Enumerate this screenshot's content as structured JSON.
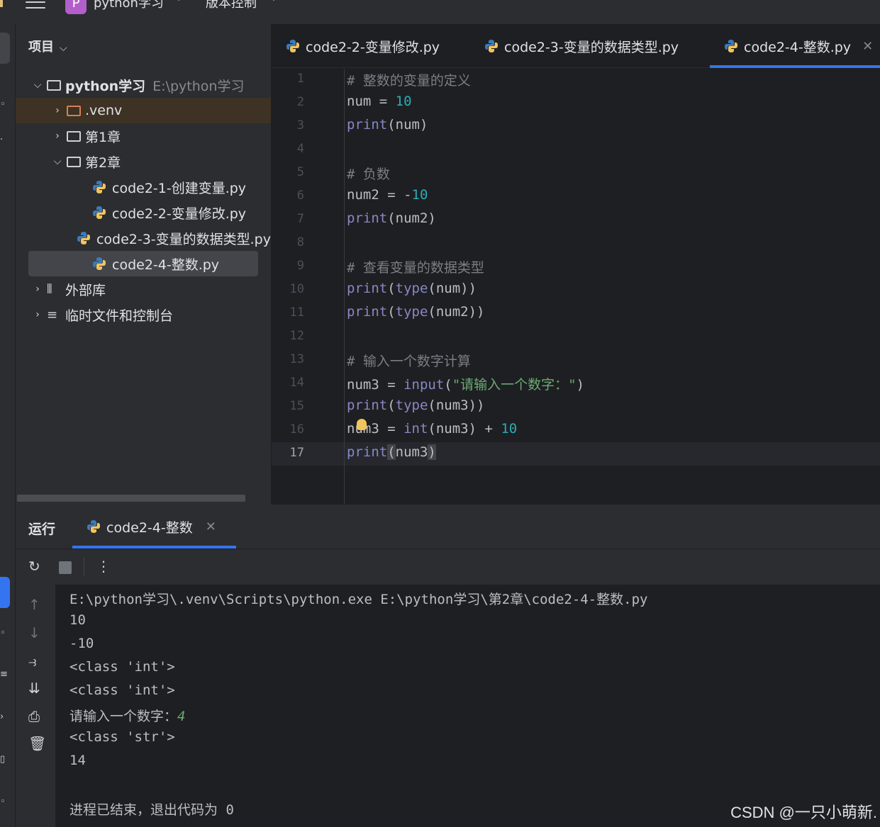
{
  "titlebar": {
    "project_badge": "P",
    "project_name": "python学习",
    "vcs_label": "版本控制"
  },
  "project_panel": {
    "header": "项目",
    "root": {
      "name": "python学习",
      "path": "E:\\python学习"
    },
    "items": [
      {
        "label": ".venv"
      },
      {
        "label": "第1章"
      },
      {
        "label": "第2章"
      },
      {
        "label": "code2-1-创建变量.py"
      },
      {
        "label": "code2-2-变量修改.py"
      },
      {
        "label": "code2-3-变量的数据类型.py"
      },
      {
        "label": "code2-4-整数.py"
      },
      {
        "label": "外部库"
      },
      {
        "label": "临时文件和控制台"
      }
    ]
  },
  "editor": {
    "tabs": [
      {
        "label": "code2-2-变量修改.py"
      },
      {
        "label": "code2-3-变量的数据类型.py"
      },
      {
        "label": "code2-4-整数.py",
        "active": true
      }
    ],
    "current_line": 17,
    "lines": [
      {
        "n": "1",
        "tokens": [
          {
            "t": "# 整数的变量的定义",
            "c": "comment"
          }
        ]
      },
      {
        "n": "2",
        "tokens": [
          {
            "t": "num = ",
            "c": ""
          },
          {
            "t": "10",
            "c": "num"
          }
        ]
      },
      {
        "n": "3",
        "tokens": [
          {
            "t": "print",
            "c": "builtin"
          },
          {
            "t": "(num)",
            "c": ""
          }
        ]
      },
      {
        "n": "4",
        "tokens": []
      },
      {
        "n": "5",
        "tokens": [
          {
            "t": "# 负数",
            "c": "comment"
          }
        ]
      },
      {
        "n": "6",
        "tokens": [
          {
            "t": "num2 = -",
            "c": ""
          },
          {
            "t": "10",
            "c": "num"
          }
        ]
      },
      {
        "n": "7",
        "tokens": [
          {
            "t": "print",
            "c": "builtin"
          },
          {
            "t": "(num2)",
            "c": ""
          }
        ]
      },
      {
        "n": "8",
        "tokens": []
      },
      {
        "n": "9",
        "tokens": [
          {
            "t": "# 查看变量的数据类型",
            "c": "comment"
          }
        ]
      },
      {
        "n": "10",
        "tokens": [
          {
            "t": "print",
            "c": "builtin"
          },
          {
            "t": "(",
            "c": ""
          },
          {
            "t": "type",
            "c": "builtin"
          },
          {
            "t": "(num))",
            "c": ""
          }
        ]
      },
      {
        "n": "11",
        "tokens": [
          {
            "t": "print",
            "c": "builtin"
          },
          {
            "t": "(",
            "c": ""
          },
          {
            "t": "type",
            "c": "builtin"
          },
          {
            "t": "(num2))",
            "c": ""
          }
        ]
      },
      {
        "n": "12",
        "tokens": []
      },
      {
        "n": "13",
        "tokens": [
          {
            "t": "# 输入一个数字计算",
            "c": "comment"
          }
        ]
      },
      {
        "n": "14",
        "tokens": [
          {
            "t": "num3 = ",
            "c": ""
          },
          {
            "t": "input",
            "c": "builtin"
          },
          {
            "t": "(",
            "c": ""
          },
          {
            "t": "\"请输入一个数字：\"",
            "c": "str"
          },
          {
            "t": ")",
            "c": ""
          }
        ]
      },
      {
        "n": "15",
        "tokens": [
          {
            "t": "print",
            "c": "builtin"
          },
          {
            "t": "(",
            "c": ""
          },
          {
            "t": "type",
            "c": "builtin"
          },
          {
            "t": "(num3))",
            "c": ""
          }
        ]
      },
      {
        "n": "16",
        "tokens": [
          {
            "t": "num3 = ",
            "c": ""
          },
          {
            "t": "int",
            "c": "builtin"
          },
          {
            "t": "(num3) + ",
            "c": ""
          },
          {
            "t": "10",
            "c": "num"
          }
        ]
      },
      {
        "n": "17",
        "tokens": [
          {
            "t": "print",
            "c": "builtin"
          },
          {
            "t": "(",
            "c": "hl"
          },
          {
            "t": "num3",
            "c": ""
          },
          {
            "t": ")",
            "c": "hl"
          }
        ]
      }
    ]
  },
  "run_panel": {
    "title": "运行",
    "tab_label": "code2-4-整数",
    "output": [
      {
        "text": "E:\\python学习\\.venv\\Scripts\\python.exe E:\\python学习\\第2章\\code2-4-整数.py"
      },
      {
        "text": "10"
      },
      {
        "text": "-10"
      },
      {
        "text": "<class 'int'>"
      },
      {
        "text": "<class 'int'>"
      },
      {
        "text": "请输入一个数字：",
        "input": "4"
      },
      {
        "text": "<class 'str'>"
      },
      {
        "text": "14"
      },
      {
        "text": ""
      },
      {
        "text": "进程已结束，退出代码为 0"
      }
    ]
  },
  "watermark": "CSDN @一只小萌新.",
  "colors": {
    "accent": "#3574f0",
    "comment": "#7a7e85",
    "number": "#2aacb8",
    "builtin": "#8888c6",
    "string": "#6aab73"
  },
  "icons": {
    "menu": "hamburger-icon",
    "python_file": "python-icon",
    "folder": "folder-icon",
    "rerun": "rerun-icon",
    "stop": "stop-icon",
    "more": "more-vertical-icon",
    "up": "arrow-up-icon",
    "down": "arrow-down-icon",
    "wrap": "soft-wrap-icon",
    "scroll_end": "scroll-to-end-icon",
    "print": "print-icon",
    "trash": "trash-icon"
  }
}
